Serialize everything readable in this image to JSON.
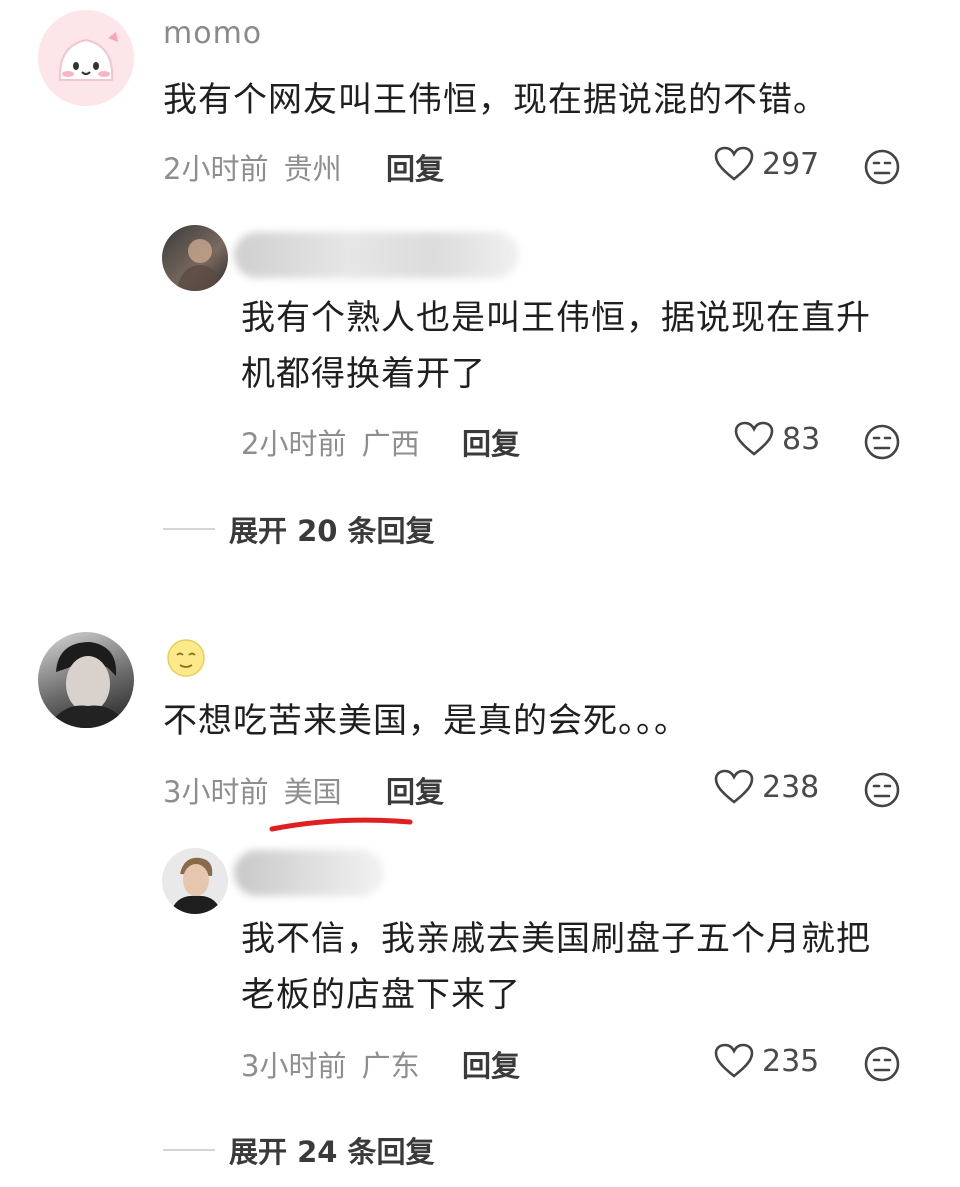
{
  "comments": [
    {
      "username": "momo",
      "text": "我有个网友叫王伟恒，现在据说混的不错。",
      "time": "2小时前",
      "location": "贵州",
      "reply_label": "回复",
      "likes": "297",
      "replies": [
        {
          "text_line1": "我有个熟人也是叫王伟恒，据说现在直升",
          "text_line2": "机都得换着开了",
          "time": "2小时前",
          "location": "广西",
          "reply_label": "回复",
          "likes": "83"
        }
      ],
      "expand_label": "展开 20 条回复"
    },
    {
      "username_icon": "moon-face-emoji",
      "text": "不想吃苦来美国，是真的会死。。。",
      "time": "3小时前",
      "location": "美国",
      "reply_label": "回复",
      "likes": "238",
      "replies": [
        {
          "text_line1": "我不信，我亲戚去美国刷盘子五个月就把",
          "text_line2": "老板的店盘下来了",
          "time": "3小时前",
          "location": "广东",
          "reply_label": "回复",
          "likes": "235"
        }
      ],
      "expand_label": "展开 24 条回复"
    }
  ],
  "colors": {
    "annotation_underline": "#e02020",
    "meta_text": "#8e8e8e",
    "body_text": "#1f1f1f"
  }
}
